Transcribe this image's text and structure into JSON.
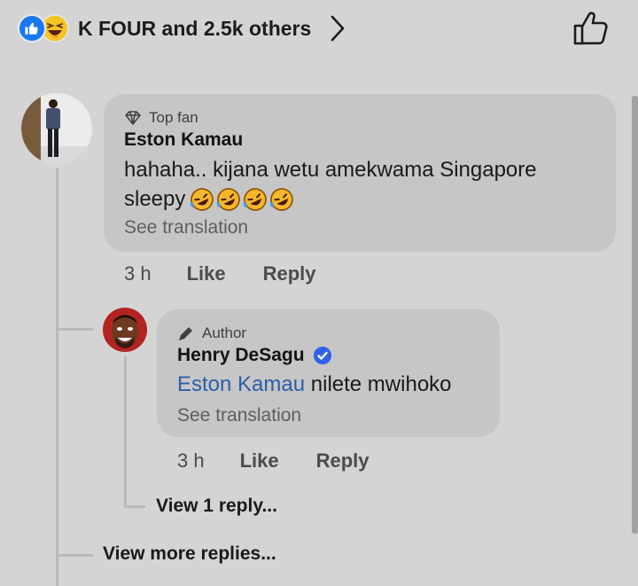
{
  "reactions": {
    "summary": "K FOUR and 2.5k others"
  },
  "comment": {
    "badge": "Top fan",
    "author": "Eston Kamau",
    "text_line1": "hahaha.. kijana wetu amekwama Singapore",
    "text_line2": "sleepy",
    "emoji_count": 4,
    "see_translation": "See translation",
    "time": "3 h",
    "like_label": "Like",
    "reply_label": "Reply"
  },
  "reply": {
    "badge": "Author",
    "author": "Henry DeSagu",
    "verified": true,
    "mention": "Eston Kamau",
    "text": "nilete mwihoko",
    "see_translation": "See translation",
    "time": "3 h",
    "like_label": "Like",
    "reply_label": "Reply"
  },
  "view_one_reply": "View 1 reply...",
  "view_more_replies": "View more replies...",
  "colors": {
    "background": "#d4d4d4",
    "bubble": "#c6c6c6",
    "accent_blue": "#1877f2",
    "mention_blue": "#2d5fa8"
  }
}
